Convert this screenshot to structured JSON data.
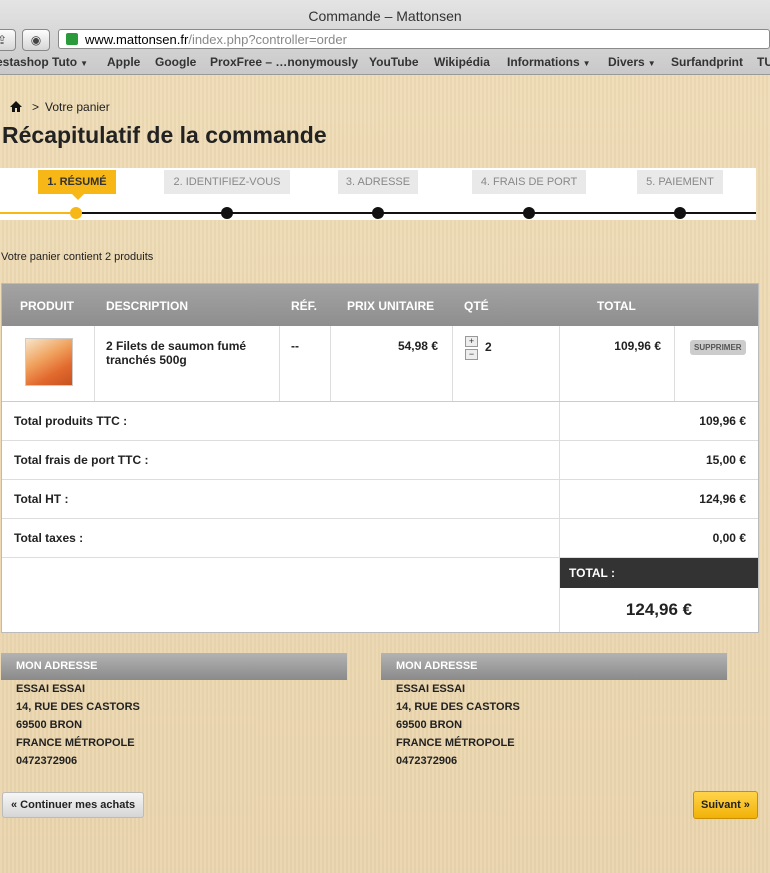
{
  "window": {
    "title": "Commande – Mattonsen"
  },
  "url": {
    "domain": "www.mattonsen.fr",
    "path": "/index.php?controller=order"
  },
  "bookmarks": [
    {
      "label": "estashop Tuto",
      "caret": true
    },
    {
      "label": "Apple",
      "caret": false
    },
    {
      "label": "Google",
      "caret": false
    },
    {
      "label": "ProxFree – …nonymously",
      "caret": false
    },
    {
      "label": "YouTube",
      "caret": false
    },
    {
      "label": "Wikipédia",
      "caret": false
    },
    {
      "label": "Informations",
      "caret": true
    },
    {
      "label": "Divers",
      "caret": true
    },
    {
      "label": "Surfandprint",
      "caret": false
    },
    {
      "label": "TU",
      "caret": false
    }
  ],
  "breadcrumb": {
    "separator": ">",
    "current": "Votre panier"
  },
  "page_title": "Récapitulatif de la commande",
  "steps": [
    {
      "label": "1. RÉSUMÉ",
      "active": true
    },
    {
      "label": "2. IDENTIFIEZ-VOUS",
      "active": false
    },
    {
      "label": "3. ADRESSE",
      "active": false
    },
    {
      "label": "4. FRAIS DE PORT",
      "active": false
    },
    {
      "label": "5. PAIEMENT",
      "active": false
    }
  ],
  "cart_summary": "Votre panier contient 2 produits",
  "table": {
    "headers": {
      "product": "PRODUIT",
      "description": "DESCRIPTION",
      "ref": "RÉF.",
      "unit_price": "PRIX UNITAIRE",
      "qty": "QTÉ",
      "total": "TOTAL"
    },
    "rows": [
      {
        "description": "2 Filets de saumon fumé tranchés 500g",
        "ref": "--",
        "unit_price": "54,98 €",
        "qty": "2",
        "total": "109,96 €",
        "delete_label": "SUPPRIMER"
      }
    ],
    "qty_plus": "+",
    "qty_minus": "−"
  },
  "totals": [
    {
      "label": "Total produits TTC :",
      "value": "109,96 €"
    },
    {
      "label": "Total frais de port TTC :",
      "value": "15,00 €"
    },
    {
      "label": "Total HT :",
      "value": "124,96 €"
    },
    {
      "label": "Total taxes :",
      "value": "0,00 €"
    }
  ],
  "grand_total": {
    "label": "TOTAL :",
    "value": "124,96 €"
  },
  "addresses": [
    {
      "title": "MON ADRESSE",
      "lines": [
        "ESSAI ESSAI",
        "14, RUE DES CASTORS",
        "69500 BRON",
        "FRANCE MÉTROPOLE",
        "0472372906"
      ]
    },
    {
      "title": "MON ADRESSE",
      "lines": [
        "ESSAI ESSAI",
        "14, RUE DES CASTORS",
        "69500 BRON",
        "FRANCE MÉTROPOLE",
        "0472372906"
      ]
    }
  ],
  "buttons": {
    "back": "« Continuer mes achats",
    "next": "Suivant »"
  },
  "colors": {
    "accent": "#f6b717",
    "header_grey": "#999999",
    "total_bg": "#333333"
  }
}
